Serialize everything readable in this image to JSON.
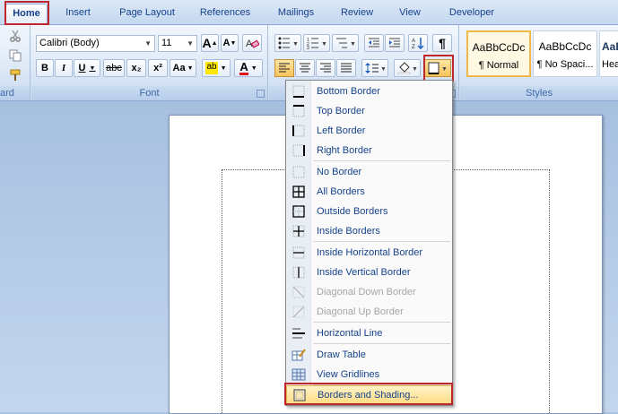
{
  "tabs": [
    {
      "label": "Home",
      "active": true
    },
    {
      "label": "Insert"
    },
    {
      "label": "Page Layout"
    },
    {
      "label": "References"
    },
    {
      "label": "Mailings"
    },
    {
      "label": "Review"
    },
    {
      "label": "View"
    },
    {
      "label": "Developer"
    }
  ],
  "clipboard": {
    "group_label": "ard"
  },
  "font": {
    "group_label": "Font",
    "font_name": "Calibri (Body)",
    "font_size": "11",
    "grow": "A",
    "shrink": "A",
    "bold": "B",
    "italic": "I",
    "underline": "U",
    "strike": "abc",
    "subscript": "x₂",
    "superscript": "x²",
    "change_case": "Aa",
    "highlight": "ab",
    "font_color": "A"
  },
  "paragraph": {
    "group_label": ""
  },
  "styles": {
    "group_label": "Styles",
    "items": [
      {
        "sample": "AaBbCcDc",
        "name": "¶ Normal"
      },
      {
        "sample": "AaBbCcDc",
        "name": "¶ No Spaci..."
      },
      {
        "sample": "AaB",
        "name": "Hea"
      }
    ]
  },
  "borders_menu": {
    "items": [
      {
        "label": "Bottom Border",
        "icon": "bottom-border-icon"
      },
      {
        "label": "Top Border",
        "icon": "top-border-icon"
      },
      {
        "label": "Left Border",
        "icon": "left-border-icon"
      },
      {
        "label": "Right Border",
        "icon": "right-border-icon"
      },
      {
        "label": "No Border",
        "icon": "no-border-icon"
      },
      {
        "label": "All Borders",
        "icon": "all-borders-icon"
      },
      {
        "label": "Outside Borders",
        "icon": "outside-borders-icon"
      },
      {
        "label": "Inside Borders",
        "icon": "inside-borders-icon"
      },
      {
        "label": "Inside Horizontal Border",
        "icon": "inside-horizontal-border-icon"
      },
      {
        "label": "Inside Vertical Border",
        "icon": "inside-vertical-border-icon"
      },
      {
        "label": "Diagonal Down Border",
        "icon": "diagonal-down-border-icon",
        "disabled": true
      },
      {
        "label": "Diagonal Up Border",
        "icon": "diagonal-up-border-icon",
        "disabled": true
      },
      {
        "label": "Horizontal Line",
        "icon": "horizontal-line-icon"
      },
      {
        "label": "Draw Table",
        "icon": "draw-table-icon"
      },
      {
        "label": "View Gridlines",
        "icon": "view-gridlines-icon"
      },
      {
        "label": "Borders and Shading...",
        "icon": "borders-shading-icon",
        "highlighted": true
      }
    ]
  },
  "colors": {
    "highlight_red": "#c0272d",
    "accent": "#15428b"
  }
}
